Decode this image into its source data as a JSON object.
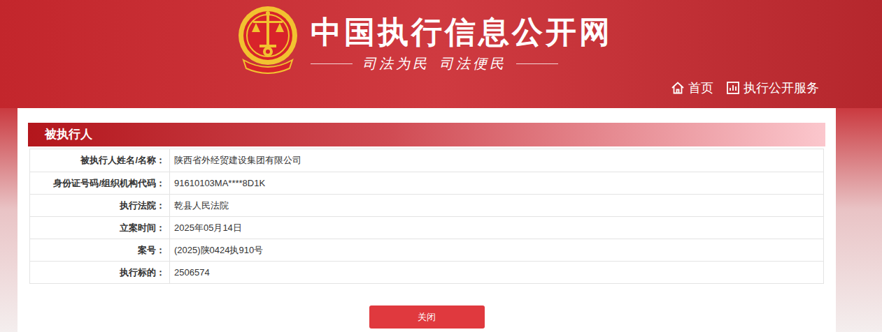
{
  "header": {
    "title": "中国执行信息公开网",
    "slogan": [
      "司法为民",
      "司法便民"
    ]
  },
  "nav": [
    {
      "label": "首页",
      "icon": "home"
    },
    {
      "label": "执行公开服务",
      "icon": "chart"
    }
  ],
  "section": {
    "title": "被执行人"
  },
  "rows": [
    {
      "label": "被执行人姓名/名称：",
      "value": "陕西省外经贸建设集团有限公司"
    },
    {
      "label": "身份证号码/组织机构代码：",
      "value": "91610103MA****8D1K"
    },
    {
      "label": "执行法院：",
      "value": "乾县人民法院"
    },
    {
      "label": "立案时间：",
      "value": "2025年05月14日"
    },
    {
      "label": "案号：",
      "value": "(2025)陕0424执910号"
    },
    {
      "label": "执行标的：",
      "value": "2506574"
    }
  ],
  "button": "关闭"
}
